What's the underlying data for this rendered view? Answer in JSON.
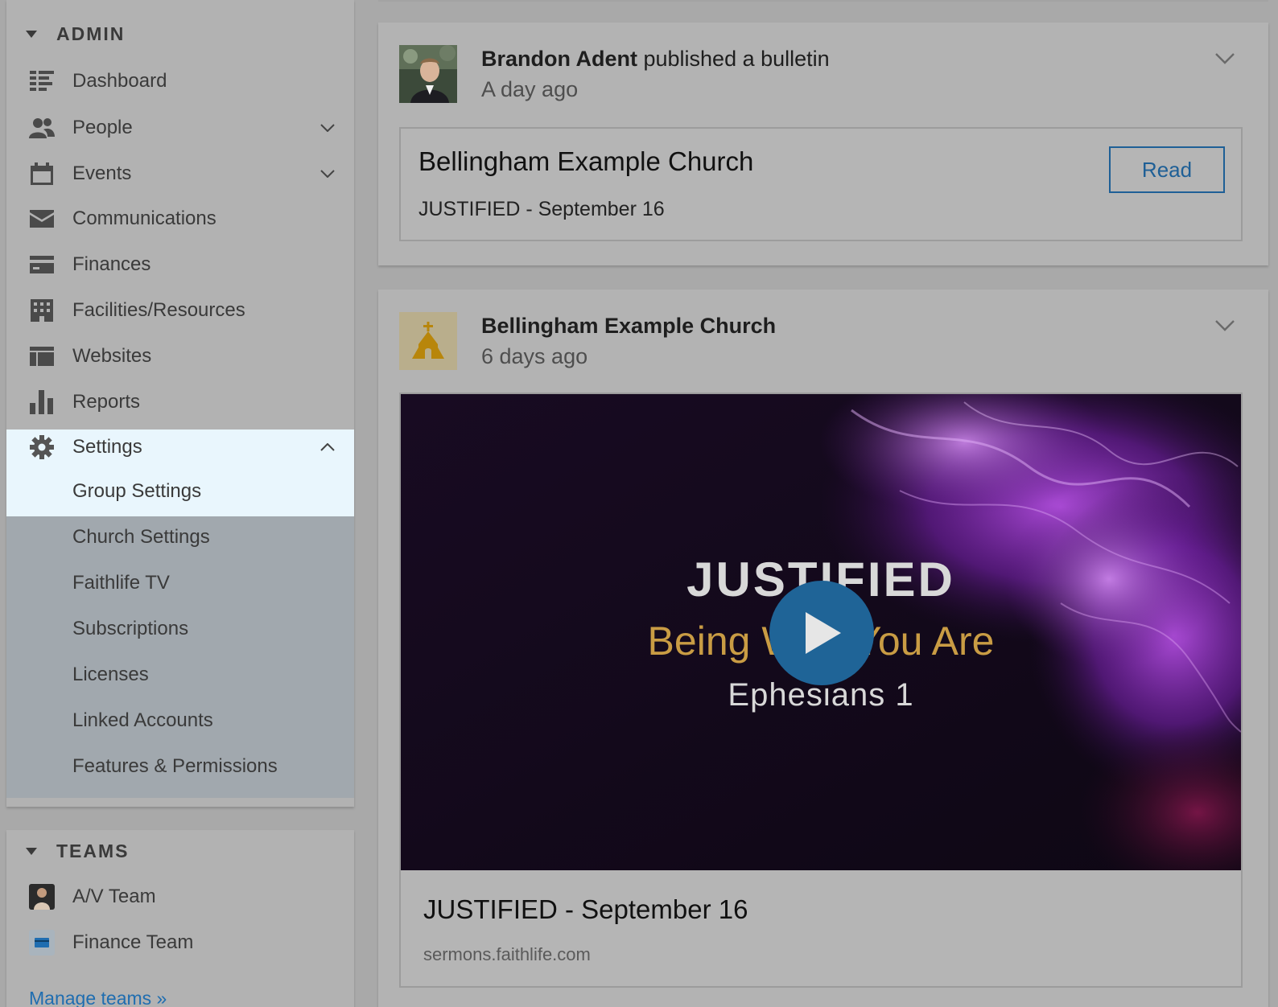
{
  "sidebar": {
    "admin_title": "ADMIN",
    "items": [
      {
        "label": "Dashboard",
        "icon": "dashboard-icon"
      },
      {
        "label": "People",
        "icon": "people-icon"
      },
      {
        "label": "Events",
        "icon": "calendar-icon"
      },
      {
        "label": "Communications",
        "icon": "envelope-icon"
      },
      {
        "label": "Finances",
        "icon": "credit-card-icon"
      },
      {
        "label": "Facilities/Resources",
        "icon": "building-icon"
      },
      {
        "label": "Websites",
        "icon": "website-icon"
      },
      {
        "label": "Reports",
        "icon": "bar-chart-icon"
      },
      {
        "label": "Settings",
        "icon": "gear-icon"
      }
    ],
    "settings_subitems": [
      "Group Settings",
      "Church Settings",
      "Faithlife TV",
      "Subscriptions",
      "Licenses",
      "Linked Accounts",
      "Features & Permissions"
    ],
    "teams_title": "TEAMS",
    "teams": [
      {
        "label": "A/V Team"
      },
      {
        "label": "Finance Team"
      }
    ],
    "manage_teams": "Manage teams »"
  },
  "feed": {
    "post1": {
      "author": "Brandon Adent",
      "action": "published a bulletin",
      "time": "A day ago",
      "bulletin_title": "Bellingham Example Church",
      "bulletin_subtitle": "JUSTIFIED - September 16",
      "read_label": "Read"
    },
    "post2": {
      "author": "Bellingham Example Church",
      "time": "6 days ago",
      "thumb_title": "JUSTIFIED",
      "thumb_subtitle": "Being Who You Are",
      "thumb_verse": "Ephesians 1",
      "caption": "JUSTIFIED - September 16",
      "link": "sermons.faithlife.com"
    }
  },
  "colors": {
    "highlight": "#e9f6fd",
    "submenu_bg": "#a1a8ae",
    "accent": "#1f6497",
    "link": "#1f6db0"
  }
}
